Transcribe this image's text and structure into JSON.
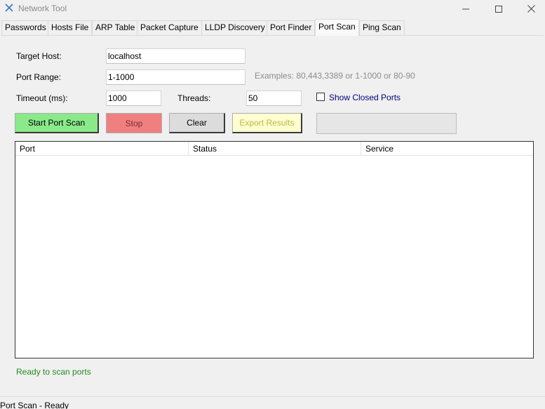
{
  "window": {
    "title": "Network Tool",
    "icon": "network-x-icon",
    "controls": [
      "minimize-icon",
      "maximize-icon",
      "close-icon"
    ]
  },
  "tabs": [
    {
      "label": "Passwords",
      "active": false
    },
    {
      "label": "Hosts File",
      "active": false
    },
    {
      "label": "ARP Table",
      "active": false
    },
    {
      "label": "Packet Capture",
      "active": false
    },
    {
      "label": "LLDP Discovery",
      "active": false
    },
    {
      "label": "Port Finder",
      "active": false
    },
    {
      "label": "Port Scan",
      "active": true
    },
    {
      "label": "Ping Scan",
      "active": false
    }
  ],
  "form": {
    "target_host_label": "Target Host:",
    "target_host_value": "localhost",
    "port_range_label": "Port Range:",
    "port_range_value": "1-1000",
    "port_range_hint": "Examples: 80,443,3389 or 1-1000 or 80-90",
    "timeout_label": "Timeout (ms):",
    "timeout_value": "1000",
    "threads_label": "Threads:",
    "threads_value": "50",
    "show_closed_label": "Show Closed Ports",
    "show_closed_checked": false
  },
  "buttons": {
    "start": "Start Port Scan",
    "stop": "Stop",
    "clear": "Clear",
    "export": "Export Results"
  },
  "progress": {
    "value": 0
  },
  "results": {
    "columns": [
      "Port",
      "Status",
      "Service"
    ],
    "rows": []
  },
  "status": "Ready to scan ports",
  "statusbar": "Port Scan - Ready",
  "colors": {
    "start_button": "#8aea8a",
    "stop_button": "#f08080",
    "clear_button": "#dcdcdc",
    "export_button": "#ffffd0",
    "status_text": "#228b22",
    "checkbox_label": "#000080"
  }
}
